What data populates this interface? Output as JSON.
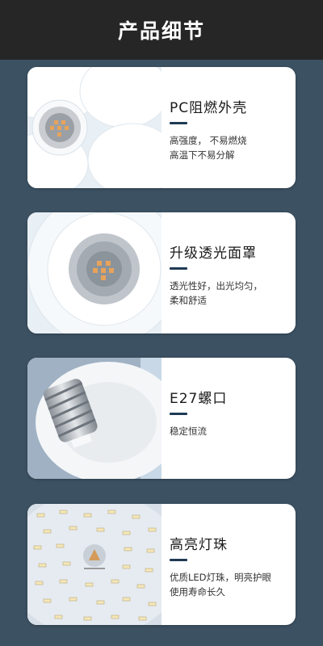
{
  "header": {
    "title": "产品细节"
  },
  "cards": [
    {
      "title": "PC阻燃外壳",
      "desc": [
        "高强度， 不易燃烧",
        "高温下不易分解"
      ],
      "image": "flower-shell-lamp"
    },
    {
      "title": "升级透光面罩",
      "desc": [
        "透光性好，出光均匀，",
        "柔和舒适"
      ],
      "image": "lampshade-closeup"
    },
    {
      "title": "E27螺口",
      "desc": [
        "稳定恒流"
      ],
      "image": "e27-screw-base"
    },
    {
      "title": "高亮灯珠",
      "desc": [
        "优质LED灯珠，明亮护眼",
        "使用寿命长久"
      ],
      "image": "led-chip-board"
    }
  ]
}
